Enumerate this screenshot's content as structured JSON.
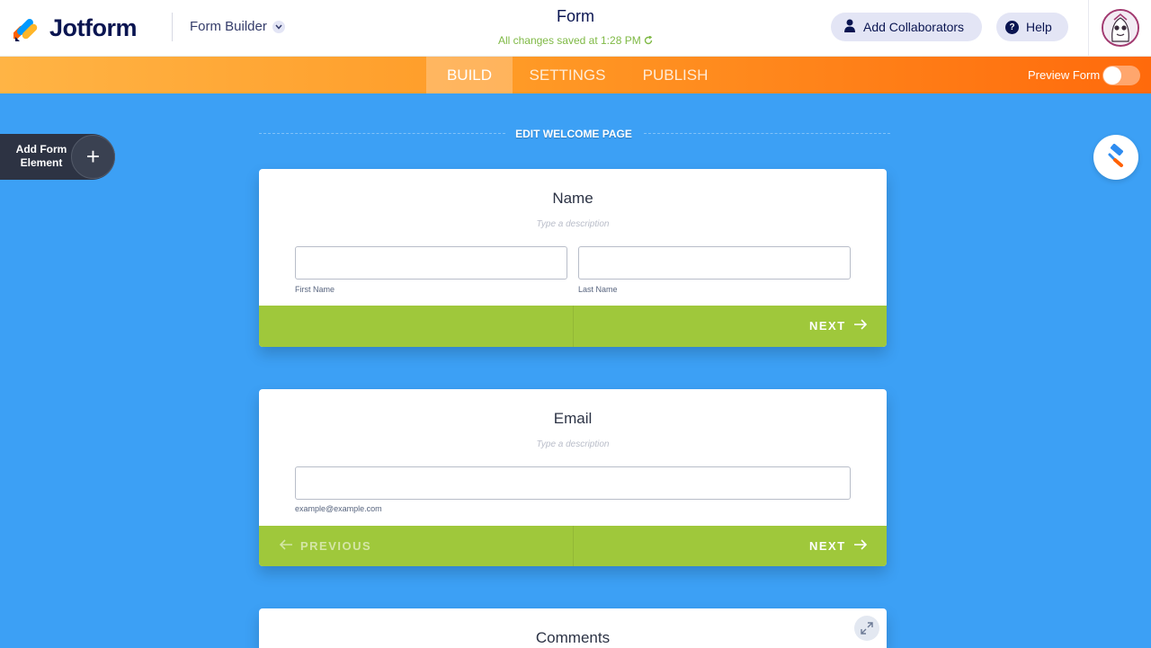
{
  "header": {
    "brand": "Jotform",
    "builder_label": "Form Builder",
    "form_title": "Form",
    "save_status": "All changes saved at 1:28 PM",
    "add_collaborators": "Add Collaborators",
    "help": "Help",
    "help_glyph": "?"
  },
  "tabs": {
    "build": "BUILD",
    "settings": "SETTINGS",
    "publish": "PUBLISH",
    "active": "BUILD"
  },
  "preview": {
    "label": "Preview Form",
    "enabled": false
  },
  "canvas": {
    "welcome_link": "EDIT WELCOME PAGE",
    "add_element_label": "Add Form Element",
    "add_element_glyph": "+"
  },
  "cards": {
    "name": {
      "title": "Name",
      "description_placeholder": "Type a description",
      "first_name_label": "First Name",
      "last_name_label": "Last Name",
      "first_name_value": "",
      "last_name_value": "",
      "next": "NEXT"
    },
    "email": {
      "title": "Email",
      "description_placeholder": "Type a description",
      "email_value": "",
      "email_sublabel": "example@example.com",
      "previous": "PREVIOUS",
      "next": "NEXT"
    },
    "comments": {
      "title": "Comments"
    }
  },
  "colors": {
    "canvas_bg": "#3ca0f5",
    "tabbar_start": "#ffb445",
    "tabbar_end": "#ff6a0c",
    "footer_green": "#9fc83b",
    "brand_navy": "#0a1551",
    "saved_green": "#7fb945"
  },
  "icons": {
    "logo": "jotform-logo-icon",
    "dropdown": "chevron-down-icon",
    "collaborator": "user-icon",
    "help": "help-circle-icon",
    "refresh": "refresh-icon",
    "avatar": "user-avatar",
    "plus": "plus-icon",
    "designer": "paint-roller-icon",
    "next": "arrow-right-icon",
    "previous": "arrow-left-icon",
    "expand": "expand-icon"
  }
}
